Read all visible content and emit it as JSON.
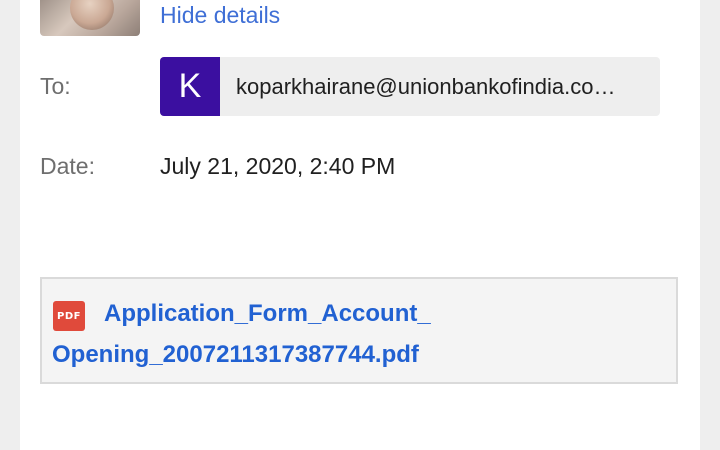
{
  "header": {
    "hide_details_label": "Hide details"
  },
  "recipient": {
    "to_label": "To:",
    "avatar_letter": "K",
    "email": "koparkhairane@unionbankofindia.co…"
  },
  "date": {
    "label": "Date:",
    "value": "July 21, 2020, 2:40 PM"
  },
  "attachment": {
    "icon_text": "PDF",
    "filename_line1": "Application_Form_Account_",
    "filename_line2": "Opening_2007211317387744.pdf"
  },
  "colors": {
    "link": "#3f6fd6",
    "attachment_link": "#2161d2",
    "avatar_bg": "#3b0fa0",
    "pdf_icon": "#e04a3b"
  }
}
